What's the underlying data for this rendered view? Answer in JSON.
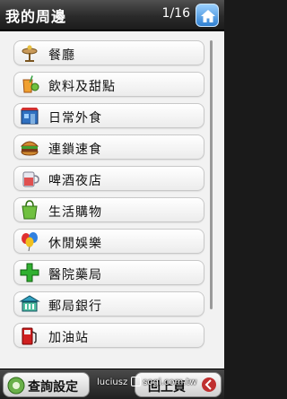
{
  "header": {
    "title": "我的周邊",
    "page_indicator": "1/16",
    "home_icon": "home-icon"
  },
  "categories": [
    {
      "label": "餐廳",
      "icon": "restaurant-icon"
    },
    {
      "label": "飲料及甜點",
      "icon": "drink-icon"
    },
    {
      "label": "日常外食",
      "icon": "shop-icon"
    },
    {
      "label": "連鎖速食",
      "icon": "burger-icon"
    },
    {
      "label": "啤酒夜店",
      "icon": "beer-icon"
    },
    {
      "label": "生活購物",
      "icon": "shopping-bag-icon"
    },
    {
      "label": "休閒娛樂",
      "icon": "balloon-icon"
    },
    {
      "label": "醫院藥局",
      "icon": "medical-cross-icon"
    },
    {
      "label": "郵局銀行",
      "icon": "bank-icon"
    },
    {
      "label": "加油站",
      "icon": "gas-pump-icon"
    }
  ],
  "footer": {
    "query_label": "查詢設定",
    "back_label": "回上頁",
    "watermark": "luciusz",
    "watermark_site": "sogi.com.tw"
  },
  "colors": {
    "header_bg": "#2a2a2a",
    "list_bg": "#f2f2f2",
    "home_button": "#2f7fd0"
  }
}
